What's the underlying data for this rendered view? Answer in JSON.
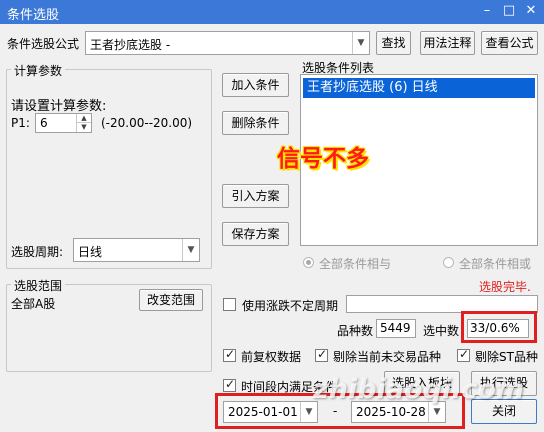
{
  "window": {
    "title": "条件选股"
  },
  "formula": {
    "label": "条件选股公式",
    "value": "王者抄底选股  -",
    "find": "查找",
    "usage": "用法注释",
    "view": "查看公式"
  },
  "params": {
    "group": "计算参数",
    "prompt": "请设置计算参数:",
    "p1_label": "P1:",
    "p1_value": "6",
    "range": "(-20.00--20.00)"
  },
  "period": {
    "label": "选股周期:",
    "value": "日线"
  },
  "conditions": {
    "add": "加入条件",
    "remove": "删除条件",
    "import": "引入方案",
    "save": "保存方案",
    "list_label": "选股条件列表",
    "items": [
      "王者抄底选股 (6) 日线"
    ],
    "overlay": "信号不多",
    "and": "全部条件相与",
    "or": "全部条件相或"
  },
  "scope": {
    "group": "选股范围",
    "value": "全部A股",
    "change": "改变范围"
  },
  "status": {
    "done": "选股完毕.",
    "use_limit": "使用涨跌不定周期",
    "count_label": "品种数",
    "count": "5449",
    "selected_label": "选中数",
    "selected": "33/0.6%"
  },
  "options": {
    "adjust": "前复权数据",
    "exclude_untraded": "剔除当前未交易品种",
    "exclude_st": "剔除ST品种",
    "time_range": "时间段内满足条件"
  },
  "dates": {
    "start": "2025-01-01",
    "sep": "-",
    "end": "2025-10-28"
  },
  "actions": {
    "to_board": "选股入板块",
    "run": "执行选股",
    "close": "关闭"
  },
  "watermark": "zhibiaoqi.com",
  "colors": {
    "titlebar": "#3b78d8",
    "highlight": "#e02020",
    "overlay_text": "#ff1a1a",
    "overlay_shadow": "#ffe100"
  }
}
